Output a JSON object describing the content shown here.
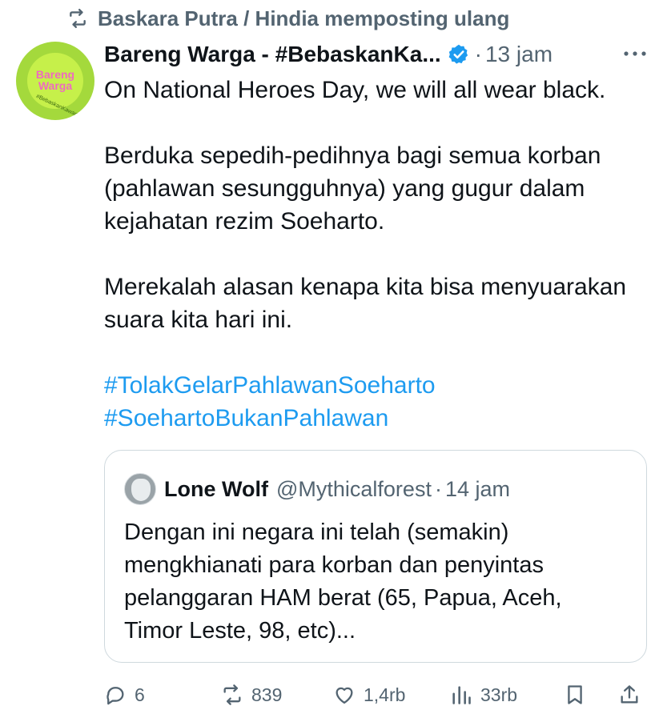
{
  "repost": {
    "text": "Baskara Putra / Hindia memposting ulang",
    "icon": "repost-icon"
  },
  "tweet": {
    "avatar_lines": [
      "Bareng",
      "Warga"
    ],
    "avatar_ring": "#BebaskanKawanKami",
    "author_name": "Bareng Warga - #BebaskanKa...",
    "verified": true,
    "separator": "·",
    "time": "13 jam",
    "paragraphs": [
      "On National Heroes Day, we will all wear black.",
      "Berduka sepedih-pedihnya bagi semua korban (pahlawan sesungguhnya) yang gugur dalam kejahatan rezim Soeharto.",
      "Merekalah alasan kenapa kita bisa menyuarakan suara kita hari ini."
    ],
    "hashtags": [
      "#TolakGelarPahlawanSoeharto",
      "#SoehartoBukanPahlawan"
    ]
  },
  "quote": {
    "name": "Lone Wolf",
    "handle": "@Mythicalforest",
    "separator": "·",
    "time": "14 jam",
    "text": "Dengan ini negara ini telah (semakin) mengkhianati para korban dan penyintas pelanggaran HAM berat (65, Papua, Aceh, Timor Leste, 98, etc)..."
  },
  "actions": {
    "replies": "6",
    "reposts": "839",
    "likes": "1,4rb",
    "views": "33rb"
  },
  "colors": {
    "text": "#0f1419",
    "muted": "#536471",
    "link": "#1d9bf0",
    "verified": "#1d9bf0",
    "border": "#cfd9de",
    "avatar_bg": "#c6f04a",
    "avatar_text": "#ef6ac0"
  }
}
